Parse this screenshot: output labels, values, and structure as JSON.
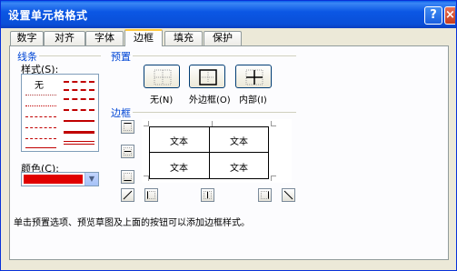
{
  "window": {
    "title": "设置单元格格式",
    "help_label": "?",
    "close_label": "×"
  },
  "tabs": [
    {
      "label": "数字"
    },
    {
      "label": "对齐"
    },
    {
      "label": "字体"
    },
    {
      "label": "边框"
    },
    {
      "label": "填充"
    },
    {
      "label": "保护"
    }
  ],
  "active_tab": "边框",
  "line_group": {
    "title": "线条",
    "style_label": "样式(S):",
    "none_label": "无",
    "color_label": "颜色(C):",
    "color_value": "#e00000"
  },
  "presets": {
    "title": "预置",
    "none_label": "无(N)",
    "outline_label": "外边框(O)",
    "inside_label": "内部(I)"
  },
  "border": {
    "title": "边框",
    "preview_cells": [
      "文本",
      "文本",
      "文本",
      "文本"
    ]
  },
  "hint": "单击预置选项、预览草图及上面的按钮可以添加边框样式。",
  "colors": {
    "accent_line": "#c00000",
    "titlebar": "#0a4fd8"
  }
}
